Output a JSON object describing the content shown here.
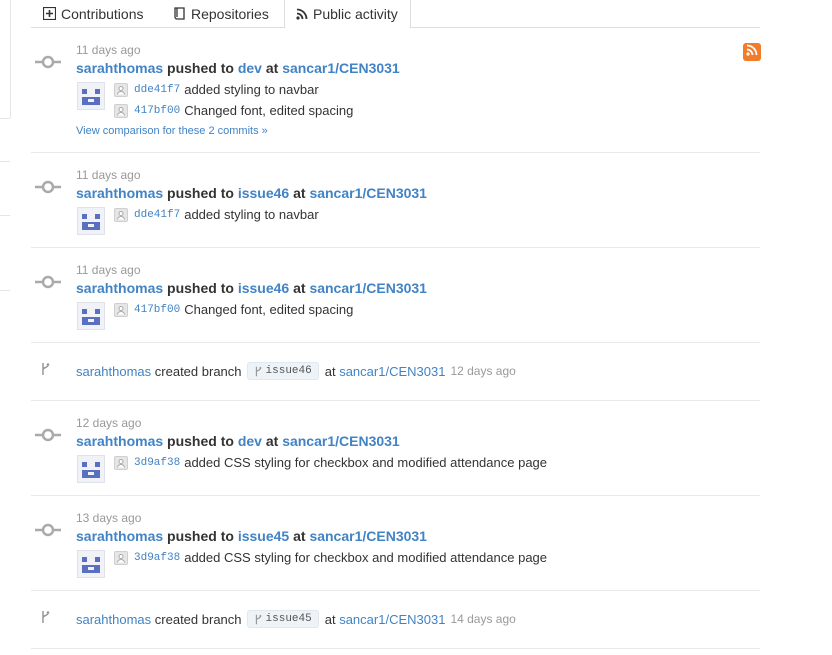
{
  "tabs": [
    {
      "label": "Contributions",
      "icon": "plus-square-icon"
    },
    {
      "label": "Repositories",
      "icon": "repo-book-icon"
    },
    {
      "label": "Public activity",
      "icon": "rss-icon",
      "selected": true
    }
  ],
  "rss": {
    "icon": "rss-feed-icon",
    "color": "#f37c2b"
  },
  "accent": "#4183c4",
  "events": [
    {
      "type": "push",
      "time": "11 days ago",
      "user": "sarahthomas",
      "verb": "pushed to",
      "branch": "dev",
      "at": "at",
      "repo": "sancar1/CEN3031",
      "commits": [
        {
          "sha": "dde41f7",
          "message": "added styling to navbar"
        },
        {
          "sha": "417bf00",
          "message": "Changed font, edited spacing"
        }
      ],
      "compare": "View comparison for these 2 commits »"
    },
    {
      "type": "push",
      "time": "11 days ago",
      "user": "sarahthomas",
      "verb": "pushed to",
      "branch": "issue46",
      "at": "at",
      "repo": "sancar1/CEN3031",
      "commits": [
        {
          "sha": "dde41f7",
          "message": "added styling to navbar"
        }
      ]
    },
    {
      "type": "push",
      "time": "11 days ago",
      "user": "sarahthomas",
      "verb": "pushed to",
      "branch": "issue46",
      "at": "at",
      "repo": "sancar1/CEN3031",
      "commits": [
        {
          "sha": "417bf00",
          "message": "Changed font, edited spacing"
        }
      ]
    },
    {
      "type": "branch",
      "user": "sarahthomas",
      "verb": "created branch",
      "branch": "issue46",
      "at": "at",
      "repo": "sancar1/CEN3031",
      "time": "12 days ago"
    },
    {
      "type": "push",
      "time": "12 days ago",
      "user": "sarahthomas",
      "verb": "pushed to",
      "branch": "dev",
      "at": "at",
      "repo": "sancar1/CEN3031",
      "commits": [
        {
          "sha": "3d9af38",
          "message": "added CSS styling for checkbox and modified attendance page"
        }
      ]
    },
    {
      "type": "push",
      "time": "13 days ago",
      "user": "sarahthomas",
      "verb": "pushed to",
      "branch": "issue45",
      "at": "at",
      "repo": "sancar1/CEN3031",
      "commits": [
        {
          "sha": "3d9af38",
          "message": "added CSS styling for checkbox and modified attendance page"
        }
      ]
    },
    {
      "type": "branch",
      "user": "sarahthomas",
      "verb": "created branch",
      "branch": "issue45",
      "at": "at",
      "repo": "sancar1/CEN3031",
      "time": "14 days ago"
    }
  ]
}
